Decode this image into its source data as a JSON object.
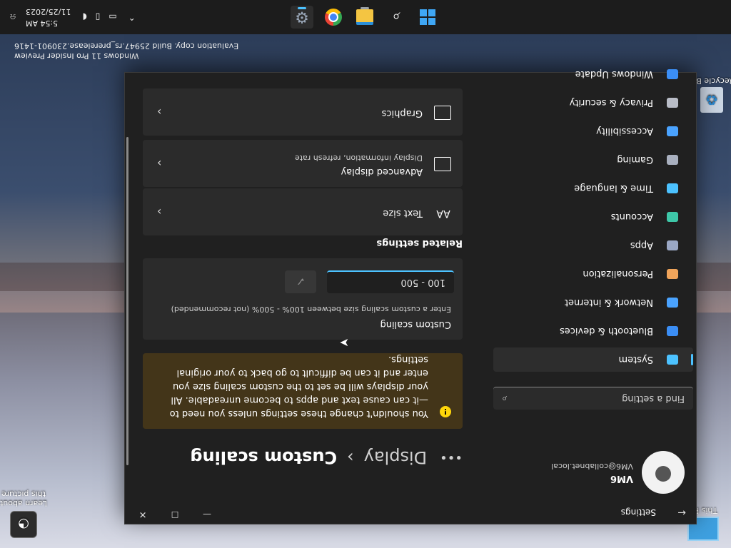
{
  "window": {
    "title": "Settings",
    "minimize": "—",
    "maximize": "☐",
    "close": "✕"
  },
  "user": {
    "name": "VM6",
    "email": "VM6@collabnet.local"
  },
  "search": {
    "placeholder": "Find a setting"
  },
  "nav": [
    {
      "label": "System",
      "icon": "system-icon",
      "color": "#4cc2ff",
      "selected": true
    },
    {
      "label": "Bluetooth & devices",
      "icon": "bluetooth-icon",
      "color": "#3b8ef5"
    },
    {
      "label": "Network & internet",
      "icon": "network-icon",
      "color": "#4aa3ff"
    },
    {
      "label": "Personalization",
      "icon": "brush-icon",
      "color": "#f0a45a"
    },
    {
      "label": "Apps",
      "icon": "apps-icon",
      "color": "#9aa7c4"
    },
    {
      "label": "Accounts",
      "icon": "accounts-icon",
      "color": "#3ec7a8"
    },
    {
      "label": "Time & language",
      "icon": "globe-clock-icon",
      "color": "#4cc2ff"
    },
    {
      "label": "Gaming",
      "icon": "gamepad-icon",
      "color": "#a9b0bf"
    },
    {
      "label": "Accessibility",
      "icon": "accessibility-icon",
      "color": "#4aa3ff"
    },
    {
      "label": "Privacy & security",
      "icon": "shield-icon",
      "color": "#b9bdc7"
    },
    {
      "label": "Windows Update",
      "icon": "update-icon",
      "color": "#3b8ef5"
    }
  ],
  "breadcrumb": {
    "more": "•••",
    "parent": "Display",
    "sep": "›",
    "current": "Custom scaling"
  },
  "warning": {
    "text": "You shouldn't change these settings unless you need to—it can cause text and apps to become unreadable. All your displays will be set to the custom scaling size you enter and it can be difficult to go back to your original settings.",
    "icon": "!"
  },
  "custom_scaling": {
    "title": "Custom scaling",
    "description": "Enter a custom scaling size between 100% - 500% (not recommended)",
    "placeholder": "100 - 500"
  },
  "related": {
    "heading": "Related settings",
    "items": [
      {
        "title": "Text size",
        "sub": "",
        "icon": "text-size-icon",
        "glyph": "AA"
      },
      {
        "title": "Advanced display",
        "sub": "Display information, refresh rate",
        "icon": "monitor-icon",
        "glyph": ""
      },
      {
        "title": "Graphics",
        "sub": "",
        "icon": "graphics-icon",
        "glyph": ""
      }
    ]
  },
  "desktop": {
    "recycle_bin": "Recycle Bin",
    "this_pc": "This PC",
    "learn_picture": "Learn about this picture",
    "watermark_1": "Windows 11 Pro Insider Preview",
    "watermark_2": "Evaluation copy. Build 25947.rs_prerelease.230901-1416"
  },
  "tray": {
    "time": "5:54 AM",
    "date": "11/25/2023"
  },
  "colors": {
    "accent": "#4cc2ff",
    "warning_bg": "#433519",
    "warning_icon": "#ffd60a"
  }
}
